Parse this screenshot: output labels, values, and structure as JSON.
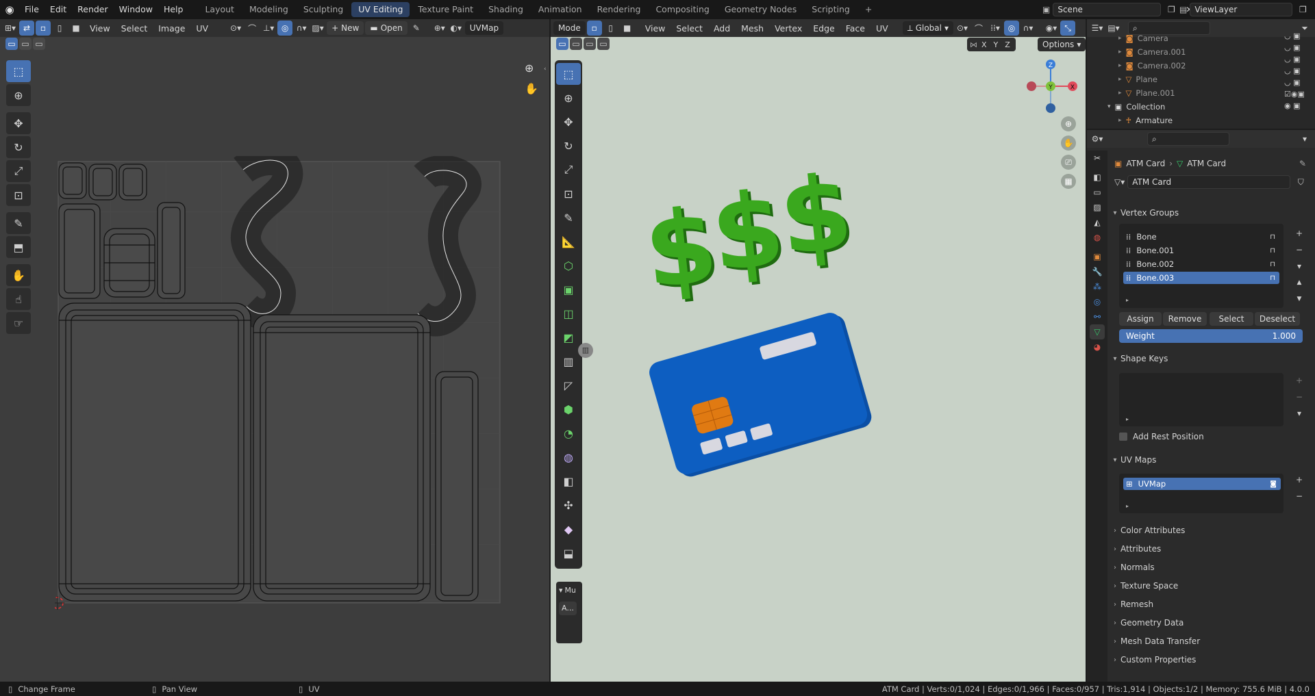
{
  "menus": [
    "File",
    "Edit",
    "Render",
    "Window",
    "Help"
  ],
  "workspaces": [
    {
      "label": "Layout",
      "active": false
    },
    {
      "label": "Modeling",
      "active": false
    },
    {
      "label": "Sculpting",
      "active": false
    },
    {
      "label": "UV Editing",
      "active": true
    },
    {
      "label": "Texture Paint",
      "active": false
    },
    {
      "label": "Shading",
      "active": false
    },
    {
      "label": "Animation",
      "active": false
    },
    {
      "label": "Rendering",
      "active": false
    },
    {
      "label": "Compositing",
      "active": false
    },
    {
      "label": "Geometry Nodes",
      "active": false
    },
    {
      "label": "Scripting",
      "active": false
    }
  ],
  "add_workspace": "+",
  "scene": "Scene",
  "view_layer": "ViewLayer",
  "uv_editor": {
    "menus": [
      "View",
      "Select",
      "Image",
      "UV"
    ],
    "new_label": "New",
    "open_label": "Open",
    "uvmap_label": "UVMap"
  },
  "viewport": {
    "mode_label": "Mode",
    "menus": [
      "View",
      "Select",
      "Add",
      "Mesh",
      "Vertex",
      "Edge",
      "Face",
      "UV"
    ],
    "transform": "Global",
    "options_label": "Options",
    "axes": [
      "X",
      "Y",
      "Z"
    ],
    "gizmo": {
      "z": "Z",
      "y": "Y",
      "x": "X"
    },
    "panel_label": "Mu",
    "panel_btn": "A...",
    "colors": {
      "card": "#0d5ec1",
      "chip": "#e07a12",
      "dollar": "#3aa81e",
      "bg": "#c8d2c7"
    }
  },
  "outliner": {
    "rows": [
      {
        "label": "Camera",
        "type": "camera"
      },
      {
        "label": "Camera.001",
        "type": "camera"
      },
      {
        "label": "Camera.002",
        "type": "camera"
      },
      {
        "label": "Plane",
        "type": "mesh"
      },
      {
        "label": "Plane.001",
        "type": "mesh"
      },
      {
        "label": "Collection",
        "type": "collection"
      },
      {
        "label": "Armature",
        "type": "armature"
      }
    ]
  },
  "properties": {
    "breadcrumb_object": "ATM Card",
    "breadcrumb_data": "ATM Card",
    "mesh_name": "ATM Card",
    "vertex_groups_title": "Vertex Groups",
    "vertex_groups": [
      {
        "label": "Bone",
        "selected": false
      },
      {
        "label": "Bone.001",
        "selected": false
      },
      {
        "label": "Bone.002",
        "selected": false
      },
      {
        "label": "Bone.003",
        "selected": true
      }
    ],
    "assign": "Assign",
    "remove": "Remove",
    "select": "Select",
    "deselect": "Deselect",
    "weight_label": "Weight",
    "weight_value": "1.000",
    "shape_keys_title": "Shape Keys",
    "add_rest_position": "Add Rest Position",
    "uv_maps_title": "UV Maps",
    "uv_maps": [
      "UVMap"
    ],
    "collapsed_sections": [
      "Color Attributes",
      "Attributes",
      "Normals",
      "Texture Space",
      "Remesh",
      "Geometry Data",
      "Mesh Data Transfer",
      "Custom Properties"
    ]
  },
  "status_bar": {
    "left": [
      {
        "label": "Change Frame"
      },
      {
        "label": "Pan View"
      },
      {
        "label": "UV"
      }
    ],
    "right": "ATM Card | Verts:0/1,024 | Edges:0/1,966 | Faces:0/957 | Tris:1,914 | Objects:1/2 | Memory: 755.6 MiB | 4.0.0"
  }
}
